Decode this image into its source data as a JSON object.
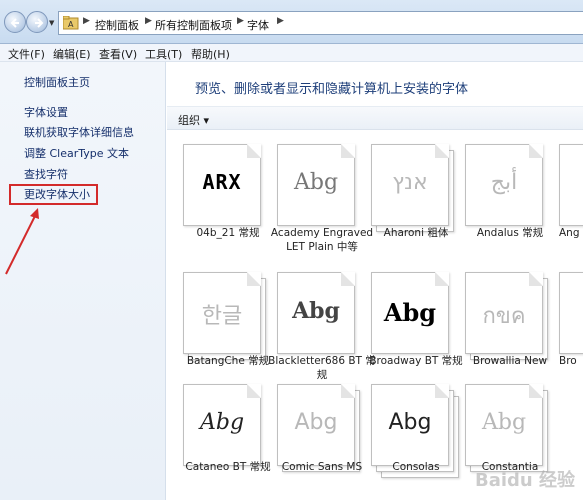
{
  "address_bar": {
    "crumbs": [
      "控制面板",
      "所有控制面板项",
      "字体"
    ]
  },
  "menu": {
    "items": [
      "文件(F)",
      "编辑(E)",
      "查看(V)",
      "工具(T)",
      "帮助(H)"
    ]
  },
  "left_panel": {
    "home": "控制面板主页",
    "links": [
      "字体设置",
      "联机获取字体详细信息",
      "调整 ClearType 文本",
      "查找字符",
      "更改字体大小"
    ]
  },
  "main": {
    "heading": "预览、删除或者显示和隐藏计算机上安装的字体",
    "organize": "组织 ▾",
    "fonts": [
      {
        "name": "04b_21 常规",
        "sample": "ARX"
      },
      {
        "name": "Academy Engraved LET Plain 中等",
        "sample": "Abg"
      },
      {
        "name": "Aharoni 粗体",
        "sample": "אנץ"
      },
      {
        "name": "Andalus 常规",
        "sample": "أبج"
      },
      {
        "name": "Ang",
        "sample": ""
      },
      {
        "name": "BatangChe 常规",
        "sample": "한글"
      },
      {
        "name": "Blackletter686 BT 常规",
        "sample": "Abg"
      },
      {
        "name": "Broadway BT 常规",
        "sample": "Abg"
      },
      {
        "name": "Browallia New",
        "sample": "กขค"
      },
      {
        "name": "Bro",
        "sample": ""
      },
      {
        "name": "Cataneo BT 常规",
        "sample": "Abg"
      },
      {
        "name": "Comic Sans MS",
        "sample": "Abg"
      },
      {
        "name": "Consolas",
        "sample": "Abg"
      },
      {
        "name": "Constantia",
        "sample": "Abg"
      }
    ]
  },
  "watermark": "Baidu 经验"
}
